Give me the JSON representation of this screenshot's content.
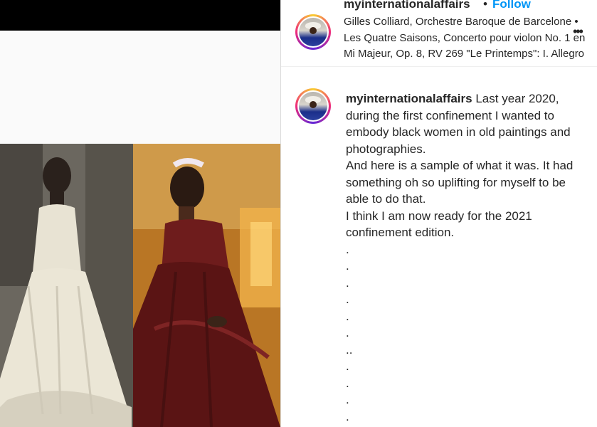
{
  "post": {
    "username": "myinternationalaffairs",
    "follow_label": "Follow",
    "separator": "•",
    "music": "Gilles Colliard, Orchestre Baroque de Barcelone • Les Quatre Saisons, Concerto pour violon No. 1 en Mi Majeur, Op. 8, RV 269 \"Le Printemps\": I. Allegro",
    "more_label": "•••"
  },
  "caption": {
    "username": "myinternationalaffairs",
    "text_first": " Last year 2020, during the first confinement I wanted to embody black women in old paintings and photographies.",
    "lines": [
      "And here is a sample of what it was. It had something oh so uplifting for myself to be able to do that.",
      "I think I am now ready for the 2021 confinement edition.",
      ".",
      ".",
      ".",
      ".",
      ".",
      ".",
      "..",
      ".",
      ".",
      ".",
      "."
    ]
  },
  "colors": {
    "follow": "#0095f6",
    "text": "#262626",
    "divider": "#dbdbdb"
  }
}
